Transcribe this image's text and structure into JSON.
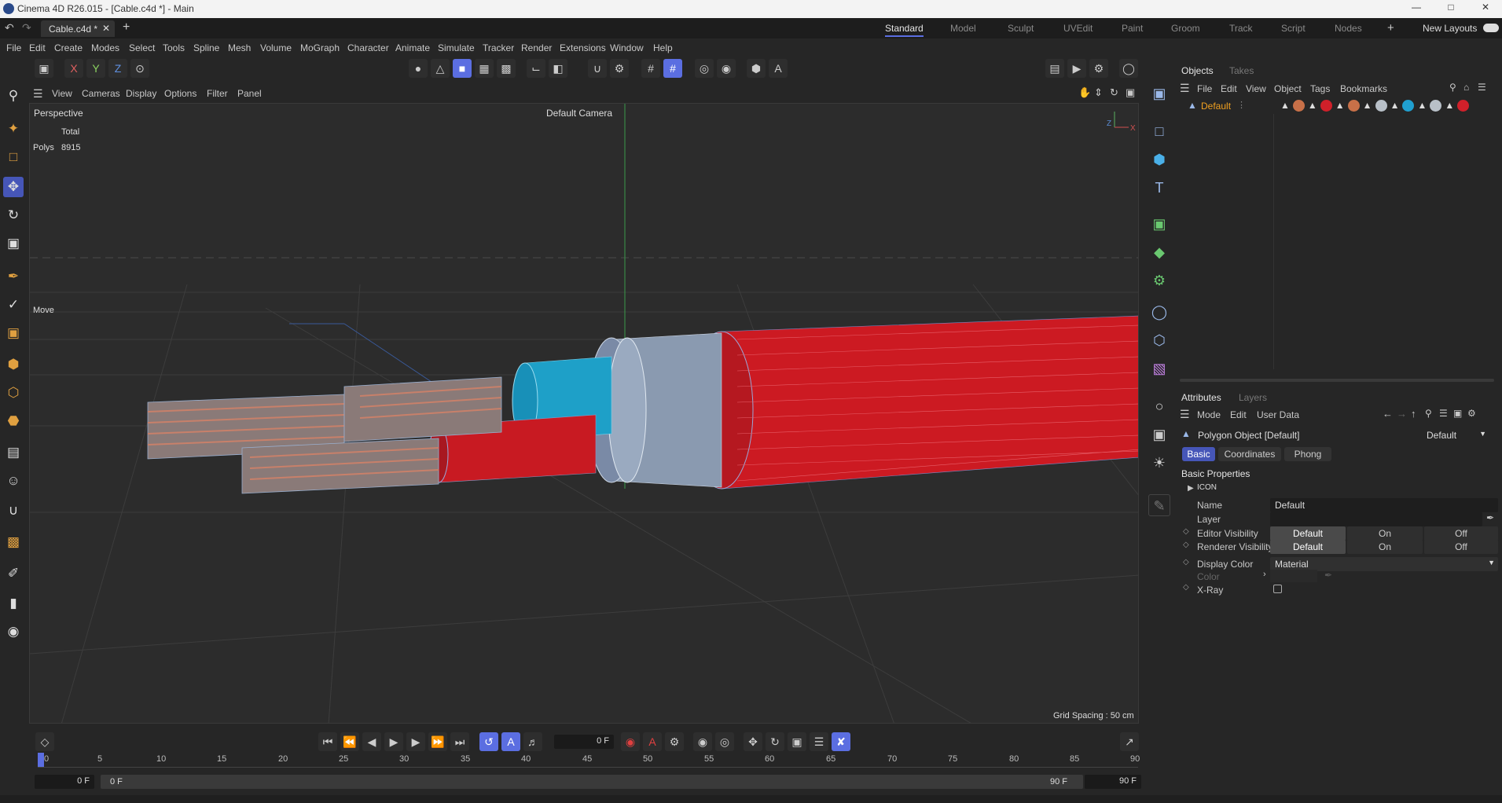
{
  "window": {
    "title": "Cinema 4D R26.015 - [Cable.c4d *] - Main"
  },
  "doc_tab": {
    "label": "Cable.c4d *"
  },
  "layouts": {
    "items": [
      "Standard",
      "Model",
      "Sculpt",
      "UVEdit",
      "Paint",
      "Groom",
      "Track",
      "Script",
      "Nodes"
    ],
    "active": "Standard",
    "new_layouts": "New Layouts"
  },
  "menu": [
    "File",
    "Edit",
    "Create",
    "Modes",
    "Select",
    "Tools",
    "Spline",
    "Mesh",
    "Volume",
    "MoGraph",
    "Character",
    "Animate",
    "Simulate",
    "Tracker",
    "Render",
    "Extensions",
    "Window",
    "Help"
  ],
  "toolbar": {
    "axis_x": "X",
    "axis_y": "Y",
    "axis_z": "Z"
  },
  "viewport": {
    "menu": [
      "View",
      "Cameras",
      "Display",
      "Options",
      "Filter",
      "Panel"
    ],
    "label": "Perspective",
    "camera": "Default Camera",
    "stats_header": "Total",
    "stats_label": "Polys",
    "stats_value": "8915",
    "tool_label": "Move",
    "grid_spacing": "Grid Spacing : 50 cm"
  },
  "objects_panel": {
    "tabs": [
      "Objects",
      "Takes"
    ],
    "menu": [
      "File",
      "Edit",
      "View",
      "Object",
      "Tags",
      "Bookmarks"
    ],
    "object_name": "Default"
  },
  "attributes_panel": {
    "tabs": [
      "Attributes",
      "Layers"
    ],
    "menu": [
      "Mode",
      "Edit",
      "User Data"
    ],
    "object_title": "Polygon Object [Default]",
    "mode_select": "Default",
    "subtabs": [
      "Basic",
      "Coordinates",
      "Phong"
    ],
    "section": "Basic Properties",
    "icon_group": "ICON",
    "name_label": "Name",
    "name_value": "Default",
    "layer_label": "Layer",
    "editor_vis_label": "Editor Visibility",
    "renderer_vis_label": "Renderer Visibility",
    "vis_options": [
      "Default",
      "On",
      "Off"
    ],
    "display_color_label": "Display Color",
    "display_color_value": "Material",
    "color_label": "Color",
    "xray_label": "X-Ray"
  },
  "timeline": {
    "current_frame": "0 F",
    "ticks": [
      "0",
      "5",
      "10",
      "15",
      "20",
      "25",
      "30",
      "35",
      "40",
      "45",
      "50",
      "55",
      "60",
      "65",
      "70",
      "75",
      "80",
      "85",
      "90"
    ],
    "start_field": "0 F",
    "range_start": "0 F",
    "range_end": "90 F",
    "end_field": "90 F"
  },
  "colors": {
    "accent": "#5b6ee1",
    "cable_red": "#d8202a",
    "wire_blue": "#1ea0c8"
  }
}
